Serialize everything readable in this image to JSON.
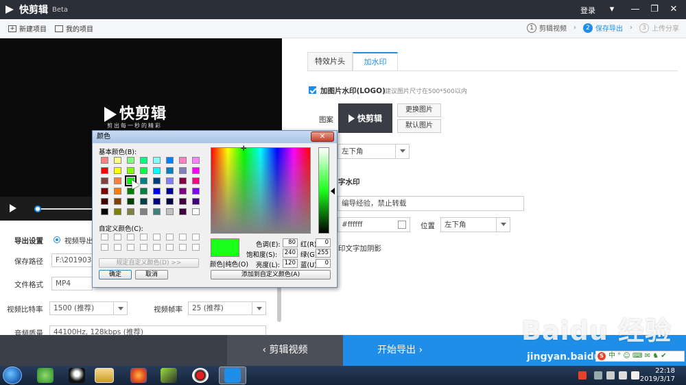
{
  "app": {
    "name": "快剪辑",
    "badge": "Beta",
    "login": "登录"
  },
  "toolbar": {
    "new_project": "新建项目",
    "my_projects": "我的项目"
  },
  "steps": [
    {
      "num": "1",
      "label": "剪辑视频"
    },
    {
      "num": "2",
      "label": "保存导出"
    },
    {
      "num": "3",
      "label": "上传分享"
    }
  ],
  "preview": {
    "brand": "快剪辑",
    "slogan": "剪出每一秒的精彩"
  },
  "export": {
    "heading": "导出设置",
    "mode": "视频导出",
    "path_label": "保存路径",
    "path_value": "F:\\2019031",
    "format_label": "文件格式",
    "format_value": "MP4",
    "bitrate_label": "视频比特率",
    "bitrate_value": "1500 (推荐)",
    "fps_label": "视频帧率",
    "fps_value": "25 (推荐)",
    "audio_label": "音频质量",
    "audio_value": "44100Hz, 128kbps (推荐)"
  },
  "right": {
    "tabs": [
      "特效片头",
      "加水印"
    ],
    "logo_watermark": "加图片水印(LOGO)",
    "logo_hint": "建议图片尺寸在500*500以内",
    "pattern_label": "图案",
    "logo_text": "快剪辑",
    "replace_btn": "更换图片",
    "default_btn": "默认图片",
    "logo_position": "左下角",
    "text_watermark": "字水印",
    "text_value": "编导经验，禁止转载",
    "color_value": "#ffffff",
    "position_label": "位置",
    "text_position": "左下角",
    "shadow_label": "印文字加阴影"
  },
  "bottom": {
    "edit_btn": "剪辑视频",
    "export_btn": "开始导出"
  },
  "dialog": {
    "title": "颜色",
    "basic_label": "基本颜色(B):",
    "custom_label": "自定义颜色(C):",
    "define_btn": "规定自定义颜色(D) >>",
    "ok": "确定",
    "cancel": "取消",
    "color_solid": "颜色|纯色(O)",
    "hue_label": "色调(E):",
    "hue": "80",
    "sat_label": "饱和度(S):",
    "sat": "240",
    "lum_label": "亮度(L):",
    "lum": "120",
    "red_label": "红(R):",
    "red": "0",
    "green_label": "绿(G):",
    "green": "255",
    "blue_label": "蓝(U):",
    "blue": "0",
    "add_custom": "添加到自定义颜色(A)",
    "basic_colors": [
      "#ff8080",
      "#ffff80",
      "#80ff80",
      "#00ff80",
      "#80ffff",
      "#0080ff",
      "#ff80c0",
      "#ff80ff",
      "#ff0000",
      "#ffff00",
      "#80ff00",
      "#00ff40",
      "#00ffff",
      "#0080c0",
      "#8080c0",
      "#ff00ff",
      "#804040",
      "#ff8040",
      "#00ff00",
      "#008080",
      "#004080",
      "#8080ff",
      "#800040",
      "#ff0080",
      "#800000",
      "#ff8000",
      "#008000",
      "#008040",
      "#0000ff",
      "#0000a0",
      "#800080",
      "#8000ff",
      "#400000",
      "#804000",
      "#004000",
      "#004040",
      "#000080",
      "#000040",
      "#400040",
      "#400080",
      "#000000",
      "#808000",
      "#808040",
      "#808080",
      "#408080",
      "#c0c0c0",
      "#400040",
      "#ffffff"
    ]
  },
  "watermark": {
    "brand": "Baidu 经验",
    "url": "jingyan.baidu.com"
  },
  "ime": {
    "text": "中 ° ☺ ⌨ ✉ ♞ ✔"
  },
  "clock": {
    "time": "22:18",
    "date": "2019/3/17"
  }
}
